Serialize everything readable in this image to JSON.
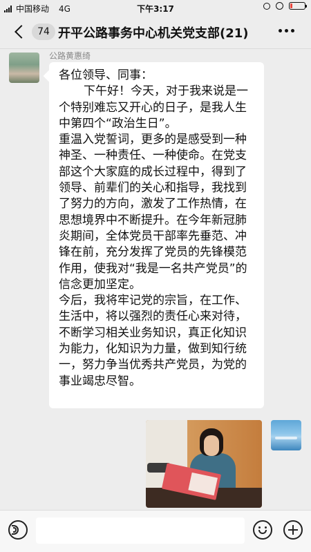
{
  "status_bar": {
    "carrier": "中国移动",
    "network": "4G",
    "time": "下午3:17",
    "battery_level": 0.15,
    "battery_color": "#e8453c"
  },
  "nav": {
    "back_icon": "chevron-left-icon",
    "unread_count": "74",
    "title": "开平公路事务中心机关党支部(21)",
    "more_icon": "more-dots-icon"
  },
  "message": {
    "sender_name": "公路黄惠绮",
    "greeting": "各位领导、同事：",
    "paragraph1": "下午好！今天，对于我来说是一个特别难忘又开心的日子，是我人生中第四个“政治生日”。",
    "paragraph2": "重温入党誓词，更多的是感受到一种神圣、一种责任、一种使命。在党支部这个大家庭的成长过程中，得到了领导、前辈们的关心和指导，我找到了努力的方向，激发了工作热情，在思想境界中不断提升。在今年新冠肺炎期间，全体党员干部率先垂范、冲锋在前，充分发挥了党员的先锋模范作用，使我对“我是一名共产党员”的信念更加坚定。",
    "paragraph3": "今后，我将牢记党的宗旨，在工作、生活中，将以强烈的责任心来对待，不断学习相关业务知识，真正化知识为能力，化知识为力量，做到知行统一，努力争当优秀共产党员，为党的事业竭忠尽智。"
  },
  "photo_message": {
    "type": "image"
  },
  "input_bar": {
    "voice_icon": "voice-icon",
    "input_value": "",
    "emoji_icon": "emoji-icon",
    "plus_icon": "plus-icon"
  },
  "colors": {
    "background": "#ededed",
    "bubble": "#ffffff"
  }
}
